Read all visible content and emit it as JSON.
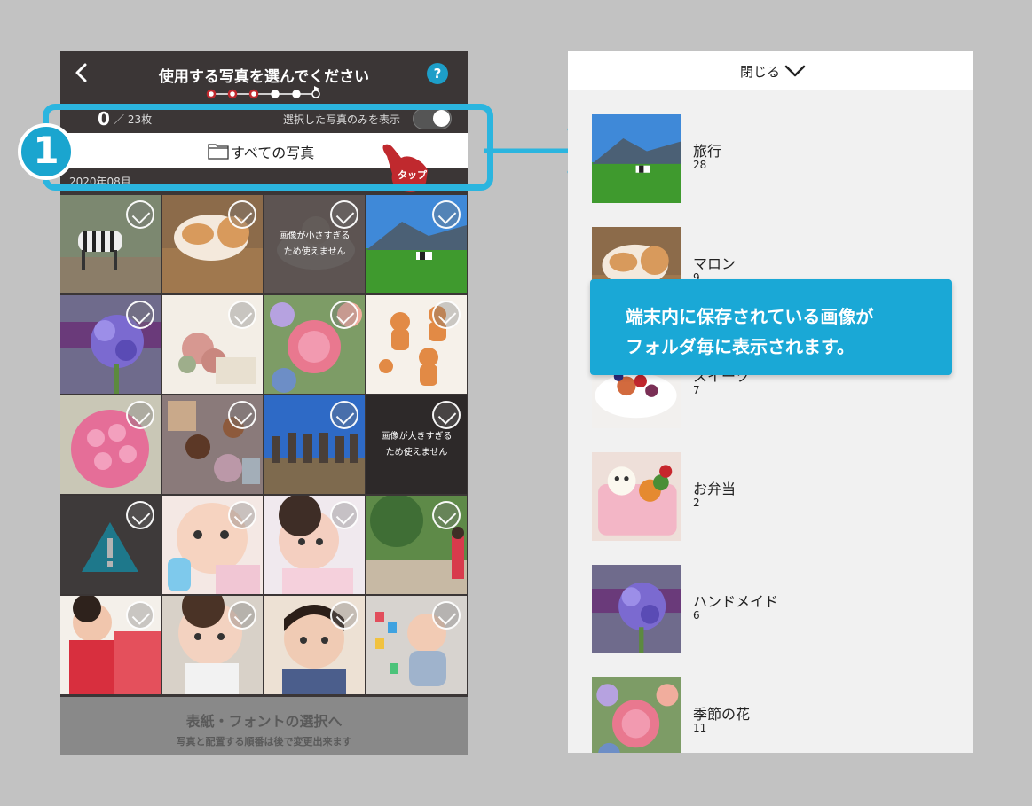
{
  "left_screen": {
    "title": "使用する写真を選んでください",
    "help_label": "?",
    "count": "0",
    "count_total": "／ 23枚",
    "selected_only_label": "選択した写真のみを表示",
    "folder_label": "すべての写真",
    "date_label": "2020年08月",
    "tap_label": "タップ",
    "tiles": [
      {
        "name": "zebra",
        "msg": ""
      },
      {
        "name": "cat",
        "msg": ""
      },
      {
        "name": "cake-too-small",
        "msg": "画像が小さすぎる\nため使えません"
      },
      {
        "name": "mountain-cows",
        "msg": ""
      },
      {
        "name": "purple-bouquet",
        "msg": ""
      },
      {
        "name": "dried-flowers",
        "msg": ""
      },
      {
        "name": "pink-ranunculus",
        "msg": ""
      },
      {
        "name": "gingerbread",
        "msg": ""
      },
      {
        "name": "rose-ball",
        "msg": ""
      },
      {
        "name": "spices",
        "msg": ""
      },
      {
        "name": "moai",
        "msg": ""
      },
      {
        "name": "too-large",
        "msg": "画像が大きすぎる\nため使えません"
      },
      {
        "name": "warning",
        "msg": ""
      },
      {
        "name": "baby-bottle",
        "msg": ""
      },
      {
        "name": "baby-lying",
        "msg": ""
      },
      {
        "name": "kimono-garden",
        "msg": ""
      },
      {
        "name": "kimono-child",
        "msg": ""
      },
      {
        "name": "baby-bib",
        "msg": ""
      },
      {
        "name": "toddler",
        "msg": ""
      },
      {
        "name": "baby-blocks",
        "msg": ""
      }
    ],
    "next_title": "表紙・フォントの選択へ",
    "next_sub": "写真と配置する順番は後で変更出来ます"
  },
  "badge_number": "1",
  "right_screen": {
    "close_label": "閉じる",
    "albums": [
      {
        "name": "旅行",
        "count": "28"
      },
      {
        "name": "マロン",
        "count": "9"
      },
      {
        "name": "スイーツ",
        "count": "7"
      },
      {
        "name": "お弁当",
        "count": "2"
      },
      {
        "name": "ハンドメイド",
        "count": "6"
      },
      {
        "name": "季節の花",
        "count": "11"
      }
    ]
  },
  "callout": {
    "line1": "端末内に保存されている画像が",
    "line2": "フォルダ毎に表示されます。"
  },
  "colors": {
    "accent": "#2bb5df",
    "header_bg": "#3b3636",
    "tap_red": "#c0292e"
  }
}
